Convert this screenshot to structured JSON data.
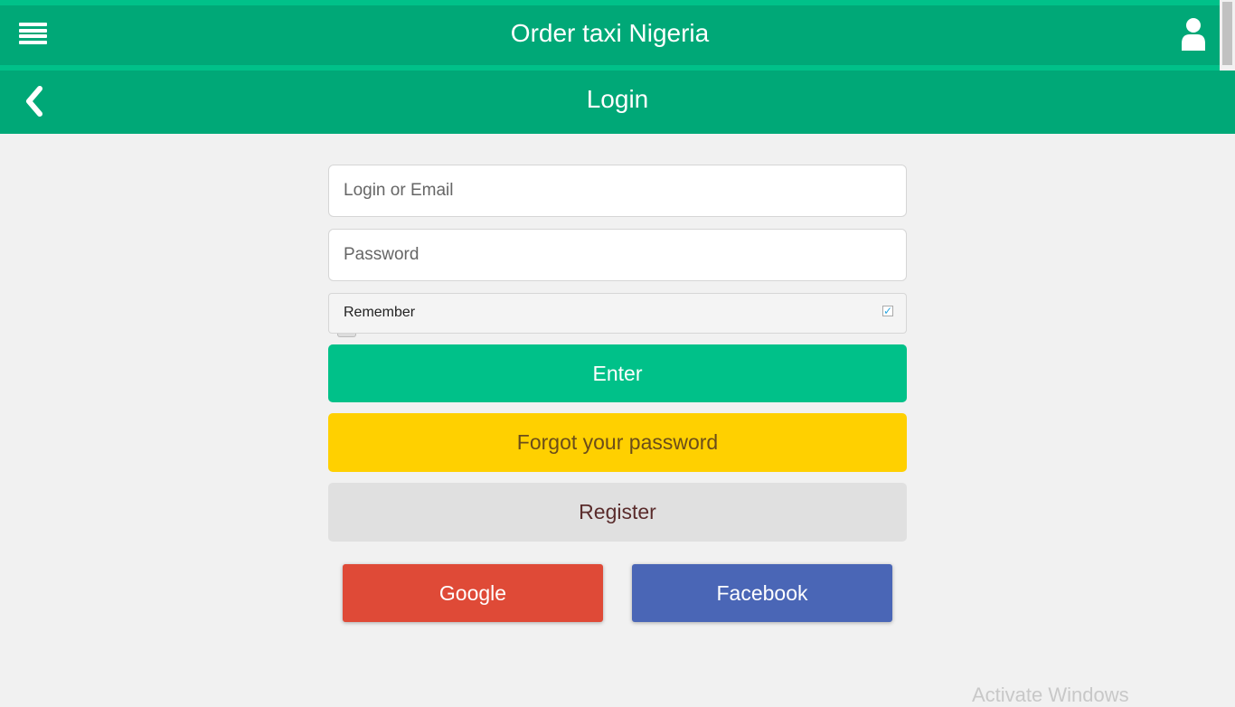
{
  "header": {
    "title": "Order taxi Nigeria",
    "menu_icon": "hamburger-icon",
    "user_icon": "user-icon"
  },
  "subheader": {
    "title": "Login",
    "back_icon": "chevron-left-icon"
  },
  "form": {
    "login_placeholder": "Login or Email",
    "password_placeholder": "Password",
    "remember_label": "Remember",
    "remember_checked": true,
    "enter_label": "Enter",
    "forgot_label": "Forgot your password",
    "register_label": "Register",
    "google_label": "Google",
    "facebook_label": "Facebook"
  },
  "colors": {
    "primary": "#00a877",
    "accent": "#00c189",
    "forgot": "#ffd000",
    "google": "#df4a37",
    "facebook": "#4a66b6"
  },
  "watermark": "Activate Windows"
}
